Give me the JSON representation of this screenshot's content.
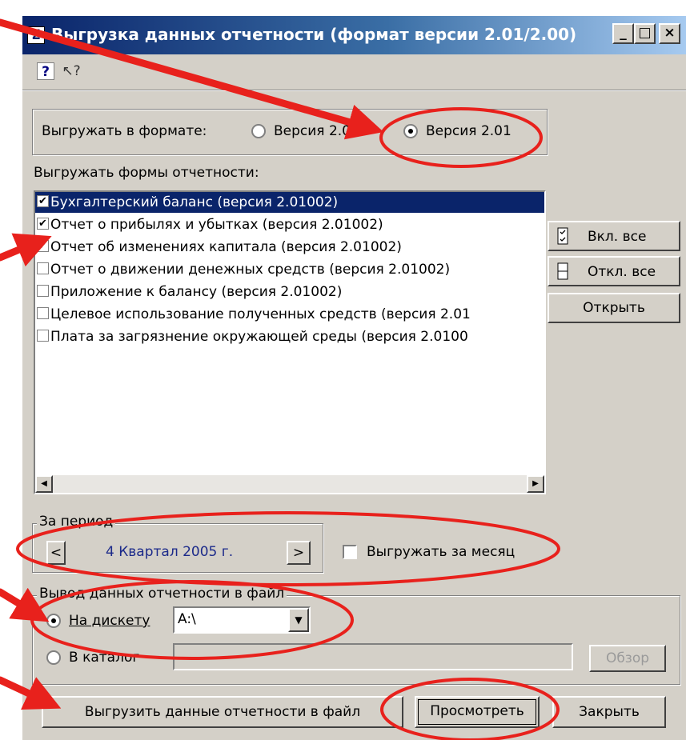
{
  "window": {
    "title": "Выгрузка данных отчетности (формат версии 2.01/2.00)",
    "app_icon_glyph": "Σ",
    "minimize": "_",
    "maximize": "□",
    "close": "×"
  },
  "toolbar": {
    "help_glyph": "?",
    "whats_this_glyph": "↖?"
  },
  "format": {
    "label": "Выгружать в формате:",
    "options": [
      {
        "label": "Версия 2.00",
        "selected": false
      },
      {
        "label": "Версия 2.01",
        "selected": true
      }
    ]
  },
  "forms": {
    "label": "Выгружать формы отчетности:",
    "items": [
      {
        "label": "Бухгалтерский баланс (версия 2.01002)",
        "checked": true,
        "selected": true
      },
      {
        "label": "Отчет о прибылях и убытках (версия 2.01002)",
        "checked": true,
        "selected": false
      },
      {
        "label": "Отчет об изменениях капитала (версия 2.01002)",
        "checked": true,
        "selected": false
      },
      {
        "label": "Отчет о движении денежных средств (версия 2.01002)",
        "checked": false,
        "selected": false
      },
      {
        "label": "Приложение к балансу (версия 2.01002)",
        "checked": false,
        "selected": false
      },
      {
        "label": "Целевое использование полученных средств (версия 2.01",
        "checked": false,
        "selected": false
      },
      {
        "label": "Плата за загрязнение окружающей среды (версия 2.0100",
        "checked": false,
        "selected": false
      }
    ],
    "check_glyph": "✔",
    "scroll_left": "◀",
    "scroll_right": "▶"
  },
  "side_buttons": {
    "check_all": "Вкл. все",
    "uncheck_all": "Откл. все",
    "open": "Открыть"
  },
  "period": {
    "caption": "За период",
    "value": "4 Квартал 2005 г.",
    "prev": "<",
    "next": ">",
    "by_month_label": "Выгружать за месяц",
    "by_month_checked": false
  },
  "output": {
    "caption": "Вывод данных отчетности в файл",
    "floppy_label": "На дискету",
    "floppy_selected": true,
    "drive_value": "A:\\",
    "dropdown_glyph": "▼",
    "folder_label": "В каталог",
    "folder_selected": false,
    "folder_path": "",
    "browse_label": "Обзор"
  },
  "bottom_buttons": {
    "export": "Выгрузить данные отчетности в файл",
    "preview": "Просмотреть",
    "close": "Закрыть"
  },
  "colors": {
    "annotation": "#e8211c",
    "title_start": "#0a246a",
    "title_end": "#a6caf0",
    "period_text": "#1c2a8a"
  }
}
